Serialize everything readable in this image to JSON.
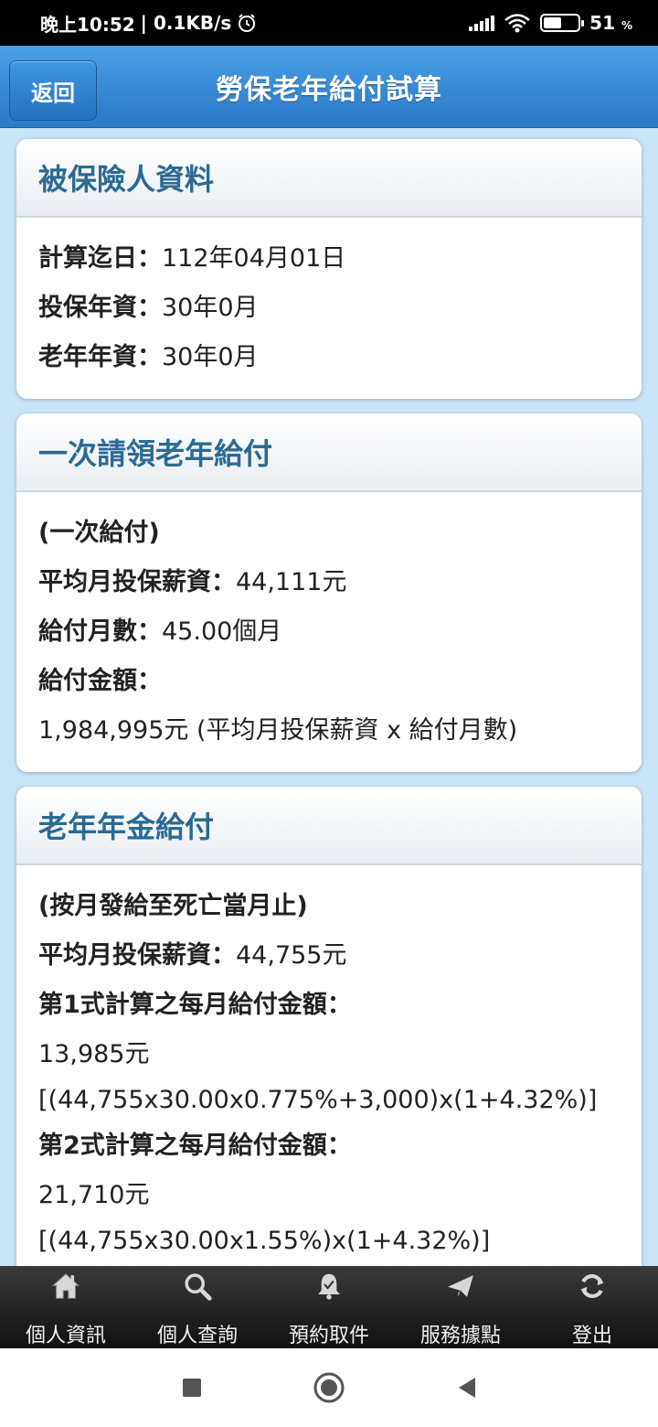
{
  "status_bar": {
    "time": "晚上10:52",
    "speed": "| 0.1KB/s",
    "battery_level": 0.51,
    "battery_text": "51",
    "battery_unit": "%"
  },
  "header": {
    "back_label": "返回",
    "title": "勞保老年給付試算"
  },
  "insured_card": {
    "title": "被保險人資料",
    "rows": [
      {
        "label": "計算迄日：",
        "value": "112年04月01日"
      },
      {
        "label": "投保年資：",
        "value": "30年0月"
      },
      {
        "label": "老年年資：",
        "value": "30年0月"
      }
    ]
  },
  "lump_card": {
    "title": "一次請領老年給付",
    "subtitle": "(一次給付)",
    "avg_label": "平均月投保薪資：",
    "avg_value": "44,111元",
    "months_label": "給付月數：",
    "months_value": "45.00個月",
    "amount_label": "給付金額：",
    "amount_value": "1,984,995元 (平均月投保薪資 x 給付月數)"
  },
  "pension_card": {
    "title": "老年年金給付",
    "subtitle": "(按月發給至死亡當月止)",
    "avg_label": "平均月投保薪資：",
    "avg_value": "44,755元",
    "formula1_label": "第1式計算之每月給付金額：",
    "formula1_amount": "13,985元",
    "formula1_expr": "[(44,755x30.00x0.775%+3,000)x(1+4.32%)]",
    "formula2_label": "第2式計算之每月給付金額：",
    "formula2_amount": "21,710元",
    "formula2_expr": "[(44,755x30.00x1.55%)x(1+4.32%)]"
  },
  "bottom_nav": {
    "items": [
      {
        "label": "個人資訊",
        "icon": "home-icon"
      },
      {
        "label": "個人查詢",
        "icon": "magnifier-icon"
      },
      {
        "label": "預約取件",
        "icon": "bell-icon"
      },
      {
        "label": "服務據點",
        "icon": "paper-plane-icon"
      },
      {
        "label": "登出",
        "icon": "refresh-icon"
      }
    ]
  },
  "colors": {
    "header_blue": "#2a78c8",
    "content_bg": "#c9e3f7",
    "card_title": "#2b6a94"
  }
}
